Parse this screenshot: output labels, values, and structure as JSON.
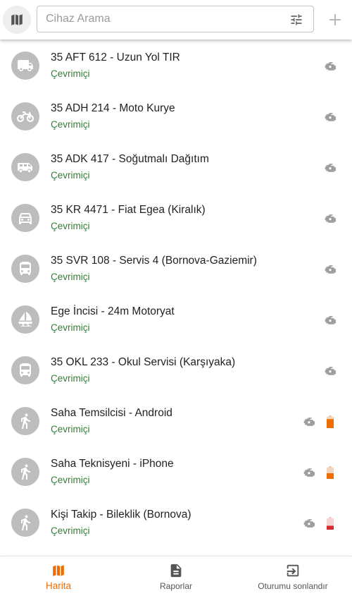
{
  "search": {
    "placeholder": "Cihaz Arama",
    "value": ""
  },
  "devices": [
    {
      "title": "35 AFT 612 - Uzun Yol TIR",
      "status": "Çevrimiçi",
      "icon": "truck-icon"
    },
    {
      "title": "35 ADH 214 - Moto Kurye",
      "status": "Çevrimiçi",
      "icon": "motorcycle-icon"
    },
    {
      "title": "35 ADK 417 - Soğutmalı Dağıtım",
      "status": "Çevrimiçi",
      "icon": "van-icon"
    },
    {
      "title": "35 KR 4471 - Fiat Egea (Kiralık)",
      "status": "Çevrimiçi",
      "icon": "car-icon"
    },
    {
      "title": "35 SVR 108 - Servis 4 (Bornova-Gaziemir)",
      "status": "Çevrimiçi",
      "icon": "bus-icon"
    },
    {
      "title": "Ege İncisi - 24m Motoryat",
      "status": "Çevrimiçi",
      "icon": "boat-icon"
    },
    {
      "title": "35 OKL 233 - Okul Servisi (Karşıyaka)",
      "status": "Çevrimiçi",
      "icon": "bus-icon"
    },
    {
      "title": "Saha Temsilcisi - Android",
      "status": "Çevrimiçi",
      "icon": "person-icon",
      "battery_level": 0.8,
      "battery_color": "#ef6c00"
    },
    {
      "title": "Saha Teknisyeni - iPhone",
      "status": "Çevrimiçi",
      "icon": "person-icon",
      "battery_level": 0.5,
      "battery_color": "#ef6c00"
    },
    {
      "title": "Kişi Takip - Bileklik (Bornova)",
      "status": "Çevrimiçi",
      "icon": "person-icon",
      "battery_level": 0.35,
      "battery_color": "#d32f2f"
    }
  ],
  "nav": {
    "map_label": "Harita",
    "reports_label": "Raporlar",
    "logout_label": "Oturumu sonlandır"
  },
  "colors": {
    "accent": "#ef6c00",
    "online": "#2e7d32",
    "avatar": "#bdbdbd"
  }
}
